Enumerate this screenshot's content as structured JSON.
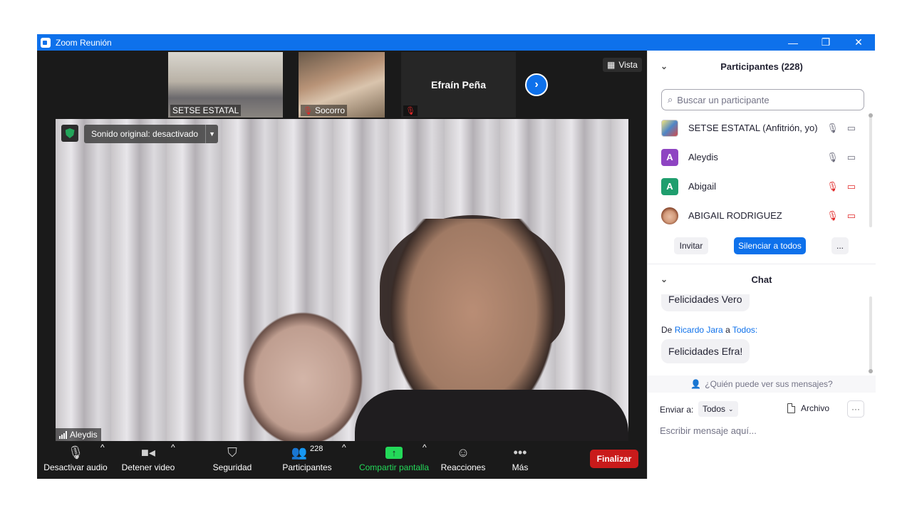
{
  "window": {
    "title": "Zoom Reunión",
    "controls": {
      "minimize": "—",
      "restore": "❐",
      "close": "✕"
    }
  },
  "strip": {
    "thumbs": [
      {
        "name": "SETSE ESTATAL",
        "muted": false
      },
      {
        "name": "Socorro",
        "muted": true
      },
      {
        "name": "Efraín Peña",
        "muted": true
      }
    ],
    "next_icon": "chevron-right-icon",
    "view_label": "Vista"
  },
  "main_video": {
    "sound_label": "Sonido original: desactivado",
    "speaker_name": "Aleydis"
  },
  "toolbar": {
    "audio_label": "Desactivar audio",
    "video_label": "Detener video",
    "security_label": "Seguridad",
    "participants_label": "Participantes",
    "participants_count": "228",
    "share_label": "Compartir pantalla",
    "reactions_label": "Reacciones",
    "more_label": "Más",
    "end_label": "Finalizar",
    "accent": "#23d959",
    "end_color": "#c91b1b"
  },
  "participants_panel": {
    "title": "Participantes (228)",
    "search_placeholder": "Buscar un participante",
    "participants": [
      {
        "name": "SETSE ESTATAL (Anfitrión, yo)",
        "avatar": "",
        "audio_muted": false,
        "video_off": false
      },
      {
        "name": "Aleydis",
        "avatar": "A",
        "avatar_color": "#8e44c2",
        "audio_muted": false,
        "video_off": false
      },
      {
        "name": "Abigail",
        "avatar": "A",
        "avatar_color": "#1f9e6e",
        "audio_muted": true,
        "video_off": true
      },
      {
        "name": "ABIGAIL RODRIGUEZ",
        "avatar": "",
        "audio_muted": true,
        "video_off": true
      }
    ],
    "invite_label": "Invitar",
    "mute_all_label": "Silenciar a todos",
    "more_label": "..."
  },
  "chat_panel": {
    "title": "Chat",
    "messages": [
      {
        "text": "Felicidades Vero"
      },
      {
        "from_prefix": "De",
        "sender": "Ricardo Jara",
        "to_word": "a",
        "recipient": "Todos:",
        "text": "Felicidades Efra!"
      }
    ],
    "who_sees": "¿Quién puede ver sus mensajes?",
    "send_to_label": "Enviar a:",
    "send_to_value": "Todos",
    "file_label": "Archivo",
    "more_label": "···",
    "input_placeholder": "Escribir mensaje aquí..."
  },
  "colors": {
    "titlebar": "#0e71eb",
    "brand_blue": "#0e71eb",
    "mute_red": "#e02828"
  }
}
